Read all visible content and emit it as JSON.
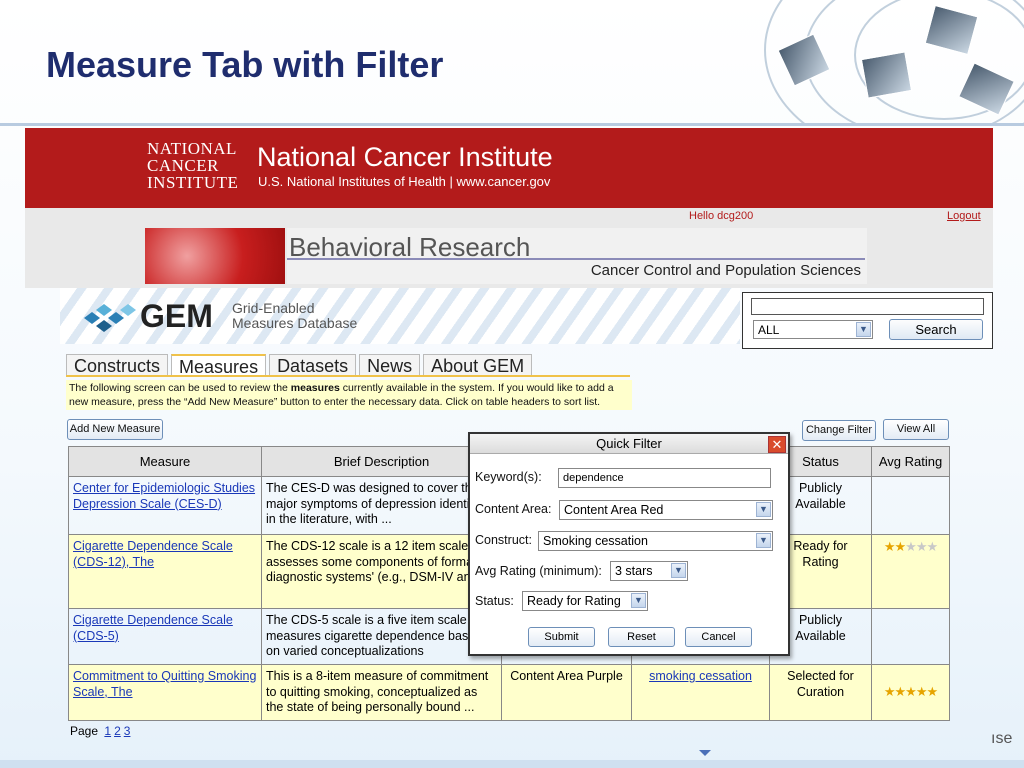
{
  "slide": {
    "title": "Measure Tab with Filter"
  },
  "nci": {
    "logo_lines": [
      "NATIONAL",
      "CANCER",
      "INSTITUTE"
    ],
    "title": "National Cancer Institute",
    "subtitle": "U.S. National Institutes of Health  |  www.cancer.gov",
    "greeting": "Hello dcg200",
    "logout": "Logout",
    "banner_title": "Behavioral Research",
    "banner_sub": "Cancer Control and Population Sciences"
  },
  "gem": {
    "name": "GEM",
    "tagline_1": "Grid-Enabled",
    "tagline_2": "Measures Database"
  },
  "search": {
    "value": "",
    "select_value": "ALL",
    "button": "Search"
  },
  "tabs": [
    "Constructs",
    "Measures",
    "Datasets",
    "News",
    "About GEM"
  ],
  "active_tab": "Measures",
  "info": {
    "part1": "The following screen can be used to review the ",
    "bold": "measures",
    "part2": " currently available in the system.  If you would like to add a new measure, press the “Add New Measure” button to enter the necessary data.  Click on table headers to sort list."
  },
  "buttons": {
    "add_measure": "Add New Measure",
    "change_filter": "Change Filter",
    "view_all": "View All"
  },
  "table": {
    "headers": [
      "Measure",
      "Brief Description",
      "",
      "",
      "Status",
      "Avg Rating"
    ],
    "rows": [
      {
        "measure": "Center for Epidemiologic Studies Depression Scale (CES-D)",
        "desc": "The CES-D was designed to cover the major symptoms of depression identified in the literature, with ...",
        "content": "",
        "construct": "",
        "status": "Publicly Available",
        "rating": 0
      },
      {
        "measure": "Cigarette Dependence Scale (CDS-12), The",
        "desc": "The CDS-12 scale is a 12 item scale that assesses some components of formal diagnostic systems' (e.g., DSM-IV and ...",
        "content": "",
        "construct": "",
        "status": "Ready for Rating",
        "rating": 2
      },
      {
        "measure": "Cigarette Dependence Scale (CDS-5)",
        "desc": "The CDS-5 scale is a five item scale that measures cigarette dependence based on varied conceptualizations",
        "content": "",
        "construct": "",
        "status": "Publicly Available",
        "rating": 0
      },
      {
        "measure": "Commitment to Quitting Smoking Scale, The",
        "desc": "This is a 8-item measure of commitment to quitting smoking, conceptualized as the state of being personally bound ...",
        "content": "Content Area Purple",
        "construct": "smoking cessation",
        "status": "Selected for Curation",
        "rating": 5
      }
    ]
  },
  "pager": {
    "label": "Page",
    "pages": [
      "1",
      "2",
      "3"
    ]
  },
  "dialog": {
    "title": "Quick Filter",
    "close": "✕",
    "keyword_label": "Keyword(s):",
    "keyword_value": "dependence",
    "content_label": "Content Area:",
    "content_value": "Content Area Red",
    "construct_label": "Construct:",
    "construct_value": "Smoking cessation",
    "rating_label": "Avg Rating (minimum):",
    "rating_value": "3 stars",
    "status_label": "Status:",
    "status_value": "Ready for Rating",
    "submit": "Submit",
    "reset": "Reset",
    "cancel": "Cancel"
  },
  "footer": {
    "corner_text": "ıse"
  },
  "colors": {
    "nci_red": "#b31b1b",
    "title_blue": "#1f2d6e",
    "highlight": "#ffffcc",
    "star": "#e6a400"
  }
}
